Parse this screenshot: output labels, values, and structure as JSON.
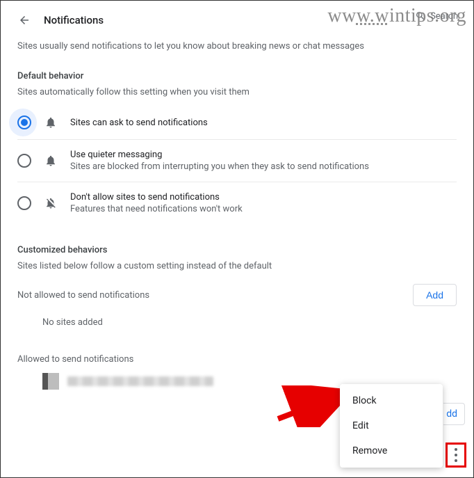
{
  "header": {
    "title": "Notifications",
    "search_placeholder": "Search"
  },
  "watermark": "www.wintips.org",
  "intro": "Sites usually send notifications to let you know about breaking news or chat messages",
  "default_behavior": {
    "title": "Default behavior",
    "subtitle": "Sites automatically follow this setting when you visit them",
    "options": [
      {
        "label": "Sites can ask to send notifications",
        "desc": "",
        "selected": true
      },
      {
        "label": "Use quieter messaging",
        "desc": "Sites are blocked from interrupting you when they ask to send notifications",
        "selected": false
      },
      {
        "label": "Don't allow sites to send notifications",
        "desc": "Features that need notifications won't work",
        "selected": false
      }
    ]
  },
  "customized": {
    "title": "Customized behaviors",
    "subtitle": "Sites listed below follow a custom setting instead of the default",
    "not_allowed": {
      "title": "Not allowed to send notifications",
      "add_label": "Add",
      "empty": "No sites added"
    },
    "allowed": {
      "title": "Allowed to send notifications",
      "add_label": "Add",
      "add_fragment": "dd"
    }
  },
  "context_menu": {
    "items": [
      "Block",
      "Edit",
      "Remove"
    ]
  }
}
